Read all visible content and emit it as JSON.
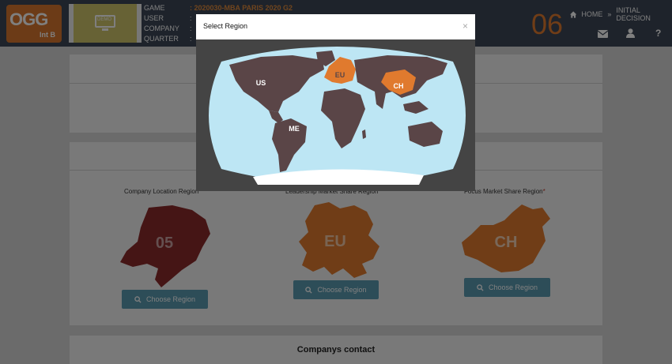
{
  "header": {
    "logo_main": "OGG",
    "logo_sub": "Int B",
    "demo_label": "DEMO",
    "fields": [
      {
        "label": "GAME",
        "value": ": 2020030-MBA PARIS 2020 G2"
      },
      {
        "label": "USER",
        "value": ":"
      },
      {
        "label": "COMPANY",
        "value": ":"
      },
      {
        "label": "QUARTER",
        "value": ":"
      }
    ],
    "round_number": "06",
    "breadcrumb": {
      "home": "HOME",
      "separator": "»",
      "current": "INITIAL DECISION"
    },
    "icons": [
      "mail-icon",
      "user-icon",
      "help-icon"
    ],
    "help_glyph": "?"
  },
  "regions": {
    "company_location": {
      "label": "Company Location Region",
      "code": "05"
    },
    "leadership_market": {
      "label": "Leadership Market Share Region",
      "code": "EU"
    },
    "focus_market": {
      "label": "Focus Market Share Region",
      "code": "CH"
    },
    "required_mark": "*",
    "button_label": "Choose Region"
  },
  "contact": {
    "title": "Companys contact"
  },
  "modal": {
    "title": "Select Region",
    "close": "×",
    "map_labels": {
      "us": "US",
      "eu": "EU",
      "ch": "CH",
      "me": "ME"
    }
  },
  "colors": {
    "header_bg": "#3d4756",
    "accent_orange": "#e07a2e",
    "region_dark_red": "#8b2a2a",
    "land": "#5a4547",
    "ocean": "#bde6f4",
    "button_blue": "#5a9ab0"
  }
}
